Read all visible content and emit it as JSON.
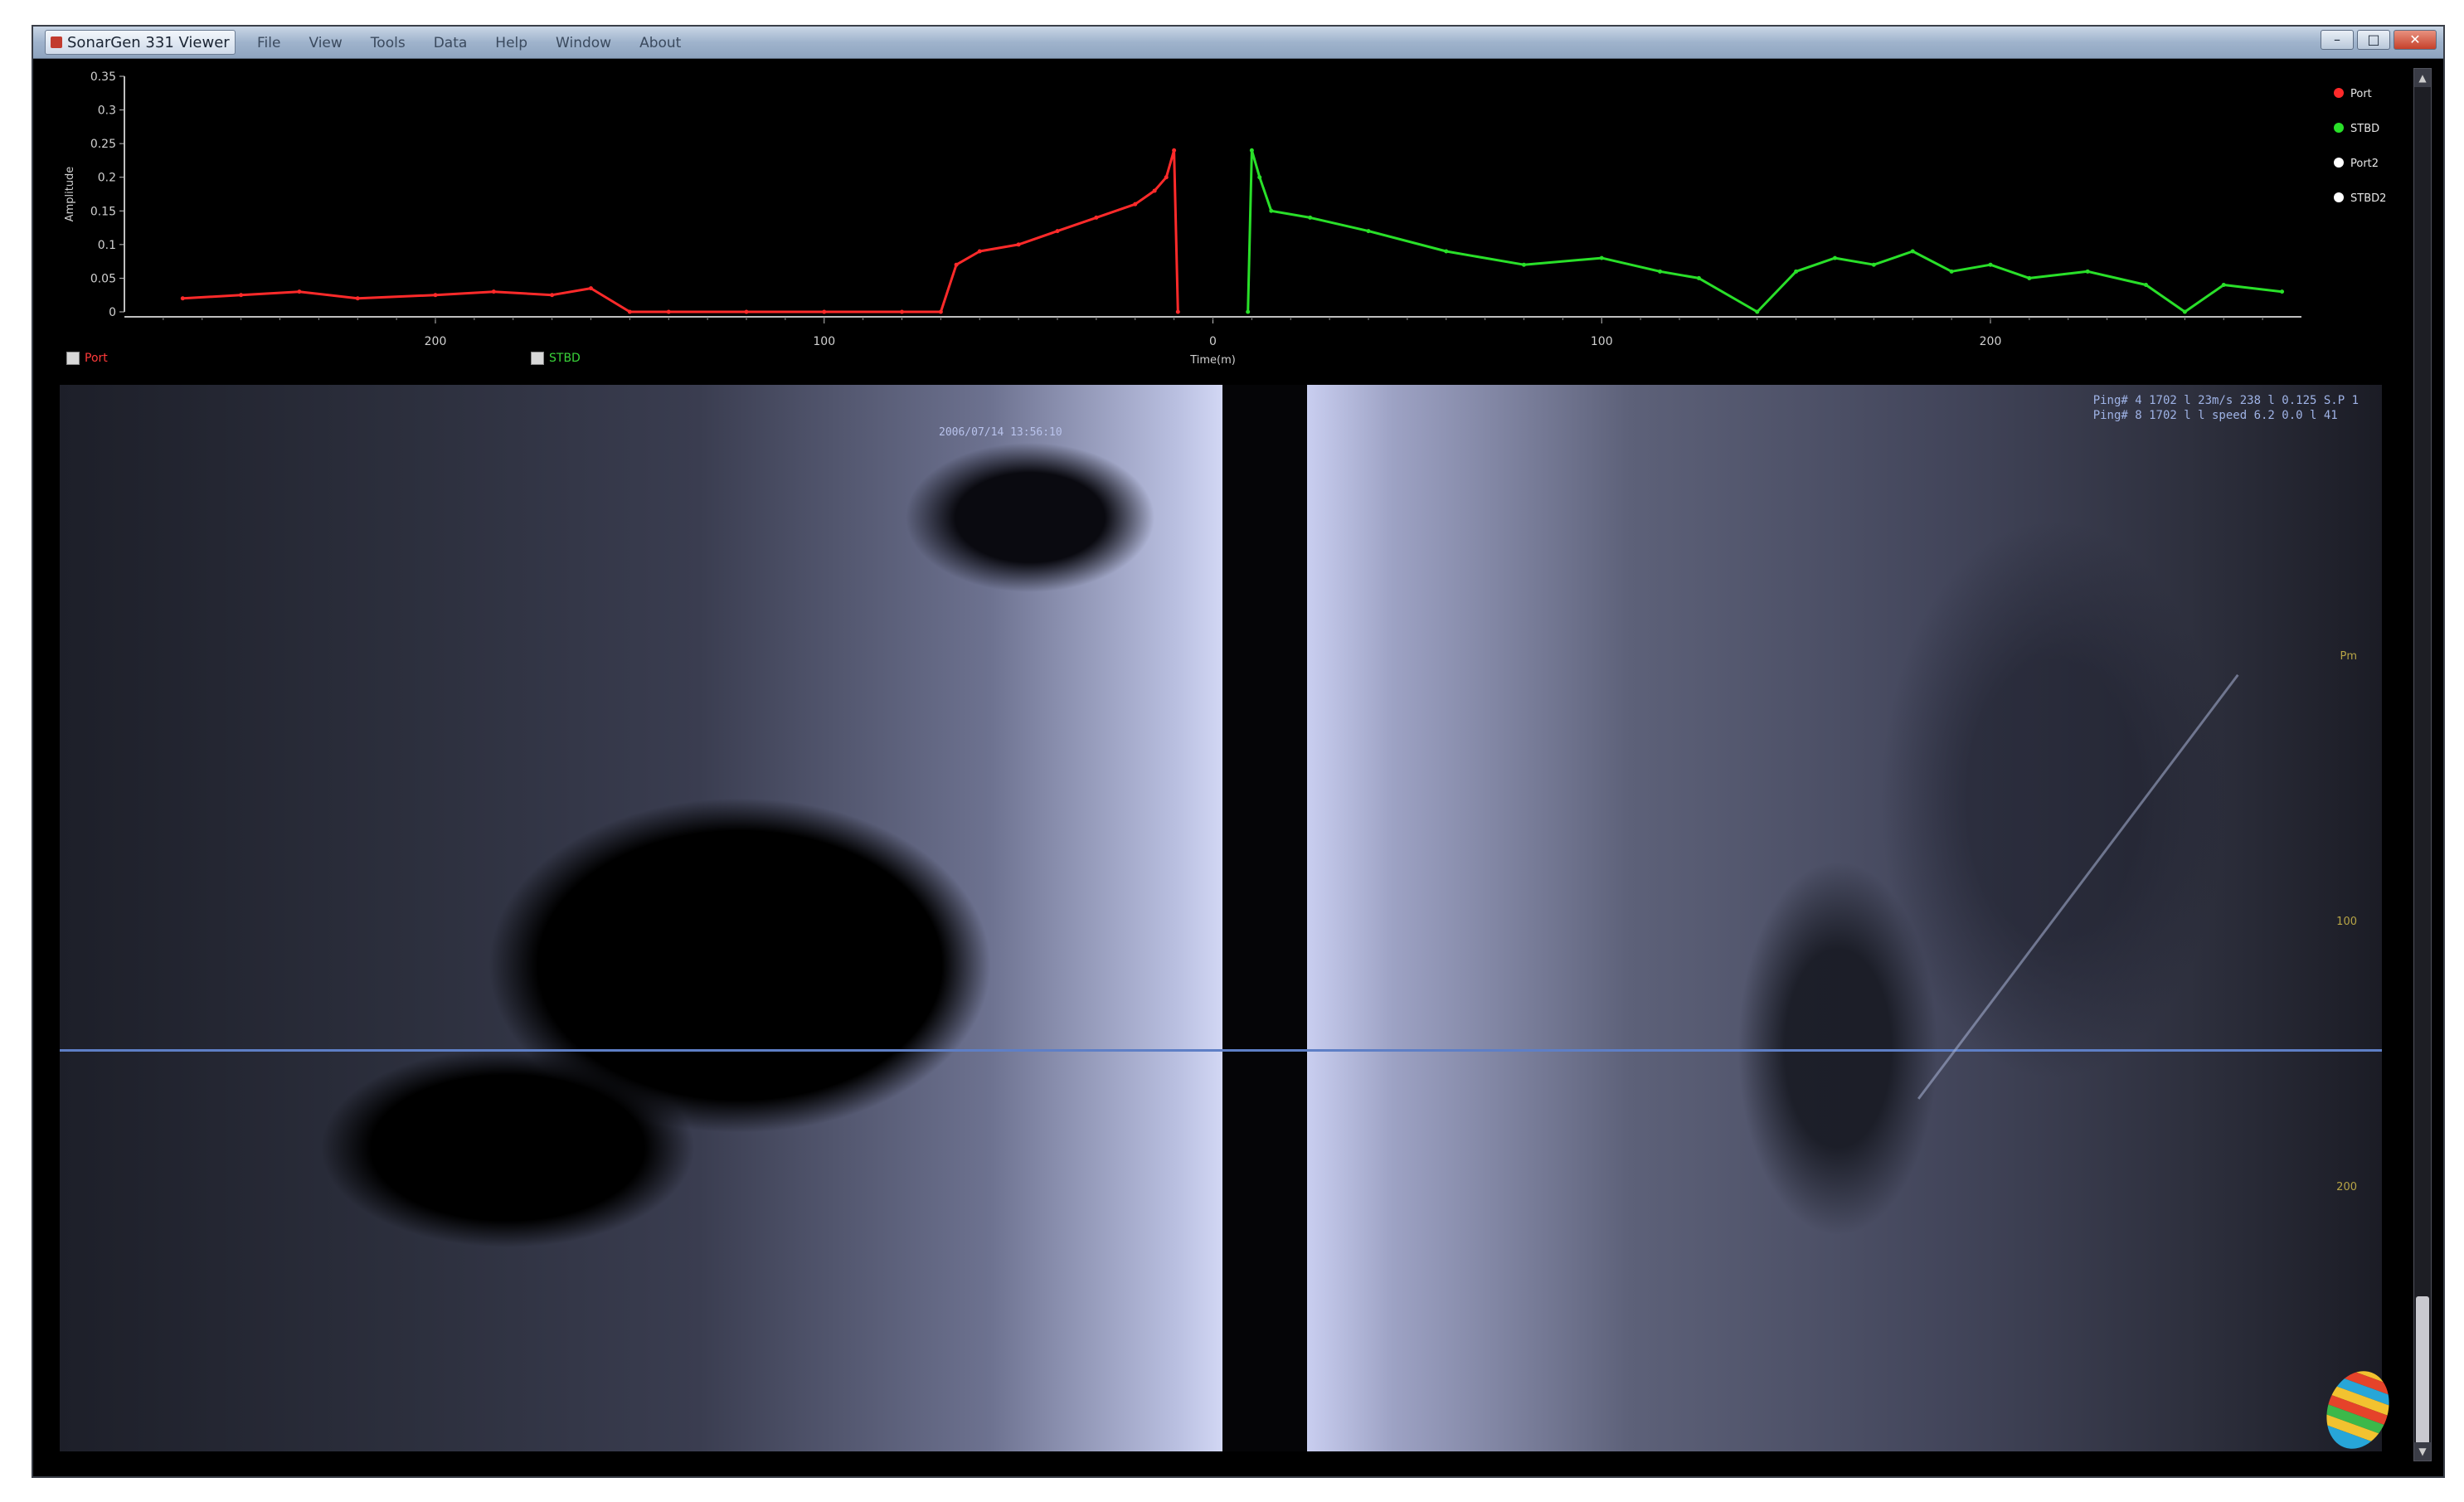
{
  "window": {
    "title": "SonarGen 331 Viewer",
    "menu": [
      "File",
      "View",
      "Tools",
      "Data",
      "Help",
      "Window",
      "About"
    ],
    "controls": {
      "minimize": "–",
      "maximize": "□",
      "close": "✕"
    }
  },
  "chart_data": {
    "type": "line",
    "title": "",
    "xlabel": "Time(m)",
    "ylabel": "Amplitude",
    "ylim": [
      0,
      0.35
    ],
    "yticks": [
      "0.35",
      "0.3",
      "0.25",
      "0.2",
      "0.15",
      "0.1",
      "0.05",
      "0"
    ],
    "xticks": [
      "200",
      "100",
      "0",
      "100",
      "200"
    ],
    "legend_position": "top-right",
    "series": [
      {
        "name": "Port",
        "color": "#ff2a2a",
        "x": [
          -265,
          -250,
          -235,
          -220,
          -200,
          -185,
          -170,
          -160,
          -150,
          -140,
          -120,
          -100,
          -80,
          -70,
          -66,
          -60,
          -50,
          -40,
          -30,
          -20,
          -15,
          -12,
          -10,
          -9
        ],
        "y": [
          0.02,
          0.025,
          0.03,
          0.02,
          0.025,
          0.03,
          0.025,
          0.035,
          0.0,
          0.0,
          0.0,
          0.0,
          0.0,
          0.0,
          0.07,
          0.09,
          0.1,
          0.12,
          0.14,
          0.16,
          0.18,
          0.2,
          0.24,
          0.0
        ]
      },
      {
        "name": "STBD",
        "color": "#29e029",
        "x": [
          9,
          10,
          12,
          15,
          25,
          40,
          60,
          80,
          100,
          115,
          125,
          140,
          150,
          160,
          170,
          180,
          190,
          200,
          210,
          225,
          240,
          250,
          260,
          275
        ],
        "y": [
          0.0,
          0.24,
          0.2,
          0.15,
          0.14,
          0.12,
          0.09,
          0.07,
          0.08,
          0.06,
          0.05,
          0.0,
          0.06,
          0.08,
          0.07,
          0.09,
          0.06,
          0.07,
          0.05,
          0.06,
          0.04,
          0.0,
          0.04,
          0.03
        ]
      }
    ],
    "legend": [
      {
        "name": "Port",
        "color": "#ff2a2a"
      },
      {
        "name": "STBD",
        "color": "#29e029"
      },
      {
        "name": "Port2",
        "color": "#ffffff"
      },
      {
        "name": "STBD2",
        "color": "#ffffff"
      }
    ]
  },
  "channels": {
    "left": {
      "label": "Port",
      "color": "#ff3a3a"
    },
    "right": {
      "label": "STBD",
      "color": "#3ad43a"
    }
  },
  "viewer": {
    "overlay_top_right": [
      "Ping# 4 1702 l 23m/s 238 l 0.125 S.P 1",
      "Ping# 8 1702 l l speed 6.2 0.0 l 41"
    ],
    "overlay_left": "2006/07/14 13:56:10",
    "range_marks": [
      "Pm",
      "100",
      "200"
    ],
    "accent_line_color": "#5e7fc6",
    "range_mark_color": "#b8a546"
  }
}
